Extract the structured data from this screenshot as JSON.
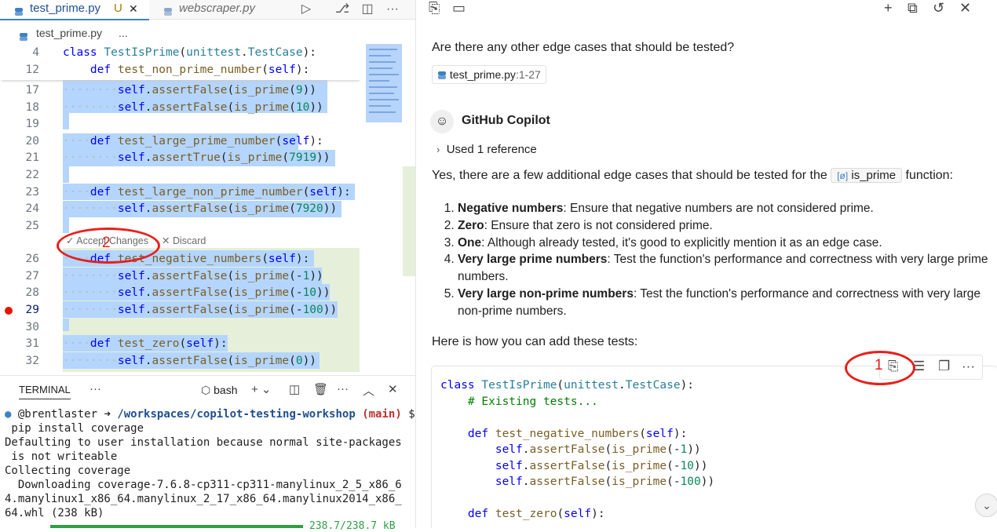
{
  "editor": {
    "tabs": [
      {
        "label": "test_prime.py",
        "status": "U",
        "close": "✕"
      },
      {
        "label": "webscraper.py"
      }
    ],
    "breadcrumb": {
      "file": "test_prime.py",
      "more": "..."
    },
    "lines": [
      {
        "num": "17",
        "text": "self.assertFalse(is_prime(9))"
      },
      {
        "num": "18",
        "text": "self.assertFalse(is_prime(10))"
      },
      {
        "num": "19",
        "text": ""
      },
      {
        "num": "20",
        "text": "def test_large_prime_number(self):"
      },
      {
        "num": "21",
        "text": "self.assertTrue(is_prime(7919))"
      },
      {
        "num": "22",
        "text": ""
      },
      {
        "num": "23",
        "text": "def test_large_non_prime_number(self):"
      },
      {
        "num": "24",
        "text": "self.assertFalse(is_prime(7920))"
      },
      {
        "num": "25",
        "text": ""
      },
      {
        "num": "26",
        "text": "def test_negative_numbers(self):"
      },
      {
        "num": "27",
        "text": "self.assertFalse(is_prime(-1))"
      },
      {
        "num": "28",
        "text": "self.assertFalse(is_prime(-10))"
      },
      {
        "num": "29",
        "text": "self.assertFalse(is_prime(-100))"
      },
      {
        "num": "30",
        "text": ""
      },
      {
        "num": "31",
        "text": "def test_zero(self):"
      },
      {
        "num": "32",
        "text": "self.assertFalse(is_prime(0))"
      }
    ],
    "sticky": [
      {
        "num": "4",
        "text": "class TestIsPrime(unittest.TestCase):"
      },
      {
        "num": "12",
        "text": "def test_non_prime_number(self):"
      }
    ],
    "accept_label": "Accept Changes",
    "discard_label": "Discard",
    "marker_2": "2"
  },
  "terminal": {
    "tab_label": "TERMINAL",
    "shell": "bash",
    "prompt_user": "@brentlaster",
    "prompt_path": "/workspaces/copilot-testing-workshop",
    "prompt_branch": "(main)",
    "prompt_symbol": "$",
    "lines": [
      " pip install coverage",
      "Defaulting to user installation because normal site-packages",
      " is not writeable",
      "Collecting coverage",
      "  Downloading coverage-7.6.8-cp311-cp311-manylinux_2_5_x86_6",
      "4.manylinux1_x86_64.manylinux_2_17_x86_64.manylinux2014_x86_",
      "64.whl (238 kB)"
    ],
    "progress_text": "238.7/238.7 kB",
    "progress_fraction": 1.0
  },
  "chat": {
    "user_question": "Are there any other edge cases that should be tested?",
    "reference_chip": "test_prime.py",
    "reference_range": ":1-27",
    "assistant_name": "GitHub Copilot",
    "used_references": "Used 1 reference",
    "intro_before": "Yes, there are a few additional edge cases that should be tested for the",
    "intro_symbol": "is_prime",
    "intro_after": "function:",
    "items": [
      {
        "bold": "Negative numbers",
        "text": ": Ensure that negative numbers are not considered prime."
      },
      {
        "bold": "Zero",
        "text": ": Ensure that zero is not considered prime."
      },
      {
        "bold": "One",
        "text": ": Although already tested, it's good to explicitly mention it as an edge case."
      },
      {
        "bold": "Very large prime numbers",
        "text": ": Test the function's performance and correctness with very large prime numbers."
      },
      {
        "bold": "Very large non-prime numbers",
        "text": ": Test the function's performance and correctness with very large non-prime numbers."
      }
    ],
    "howto": "Here is how you can add these tests:",
    "marker_1": "1",
    "code_lines": [
      "class TestIsPrime(unittest.TestCase):",
      "    # Existing tests...",
      "",
      "    def test_negative_numbers(self):",
      "        self.assertFalse(is_prime(-1))",
      "        self.assertFalse(is_prime(-10))",
      "        self.assertFalse(is_prime(-100))",
      "",
      "    def test_zero(self):"
    ]
  },
  "icons": [
    "python-file-icon",
    "run-icon",
    "source-control-icon",
    "split-editor-icon",
    "more-icon",
    "new-chat-icon",
    "history-icon",
    "close-icon",
    "apply-in-editor-icon",
    "insert-icon",
    "copy-icon",
    "chevron-down-icon",
    "trash-icon",
    "maximize-icon"
  ],
  "colors": {
    "accent": "#3b82c4",
    "annotation": "#e8201b",
    "diff_added": "#e6efd9",
    "selection": "#b4d5fe",
    "breakpoint": "#e51400"
  }
}
